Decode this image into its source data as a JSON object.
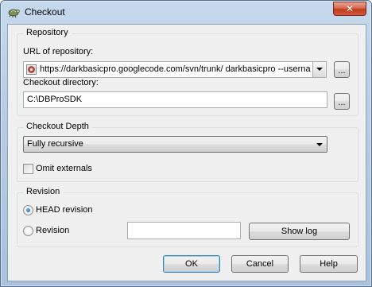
{
  "window": {
    "title": "Checkout",
    "close_glyph": "✕"
  },
  "repository": {
    "group_label": "Repository",
    "url_label": "URL of repository:",
    "url_value": "https://darkbasicpro.googlecode.com/svn/trunk/ darkbasicpro --userna",
    "browse_label": "...",
    "dir_label": "Checkout directory:",
    "dir_value": "C:\\DBProSDK",
    "dir_browse_label": "..."
  },
  "depth": {
    "group_label": "Checkout Depth",
    "selected": "Fully recursive",
    "omit_externals_label": "Omit externals",
    "omit_externals_checked": false
  },
  "revision": {
    "group_label": "Revision",
    "head_label": "HEAD revision",
    "head_checked": true,
    "revision_label": "Revision",
    "revision_checked": false,
    "revision_value": "",
    "show_log_label": "Show log"
  },
  "buttons": {
    "ok": "OK",
    "cancel": "Cancel",
    "help": "Help"
  },
  "colors": {
    "accent": "#3c7fb1",
    "close": "#c0391d"
  },
  "icons": {
    "app": "tortoise-icon",
    "url": "repository-icon"
  }
}
